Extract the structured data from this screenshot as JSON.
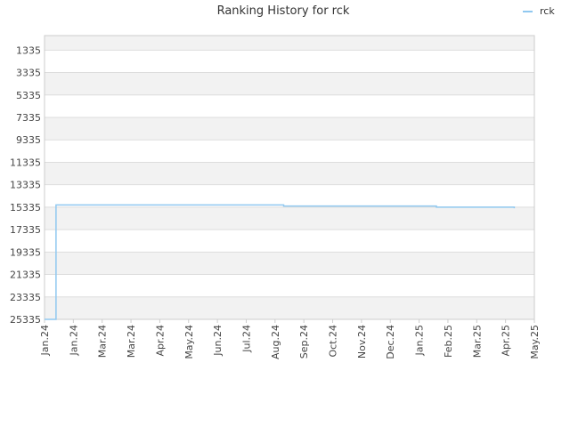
{
  "chart_data": {
    "type": "line",
    "title": "Ranking History for rck",
    "xlabel": "",
    "ylabel": "",
    "y_inverted": true,
    "ylim": [
      25335,
      1335
    ],
    "y_ticks": [
      1335,
      3335,
      5335,
      7335,
      9335,
      11335,
      13335,
      15335,
      17335,
      19335,
      21335,
      23335,
      25335
    ],
    "x_tick_labels": [
      "Jan.24",
      "Jan.24",
      "Mar.24",
      "Mar.24",
      "Apr.24",
      "May.24",
      "Jun.24",
      "Jul.24",
      "Aug.24",
      "Sep.24",
      "Oct.24",
      "Nov.24",
      "Dec.24",
      "Jan.25",
      "Feb.25",
      "Mar.25",
      "Apr.25",
      "May.25"
    ],
    "grid": true,
    "legend_position": "top-right",
    "colors": {
      "series": "#90c8f0",
      "band": "#f2f2f2",
      "grid": "#dddddd",
      "axis": "#cccccc"
    },
    "series": [
      {
        "name": "rck",
        "step": true,
        "x": [
          0.0,
          0.4,
          0.4,
          3.0,
          8.3,
          13.6,
          16.3
        ],
        "y": [
          25335,
          25335,
          15135,
          15135,
          15235,
          15335,
          15435
        ]
      }
    ]
  }
}
